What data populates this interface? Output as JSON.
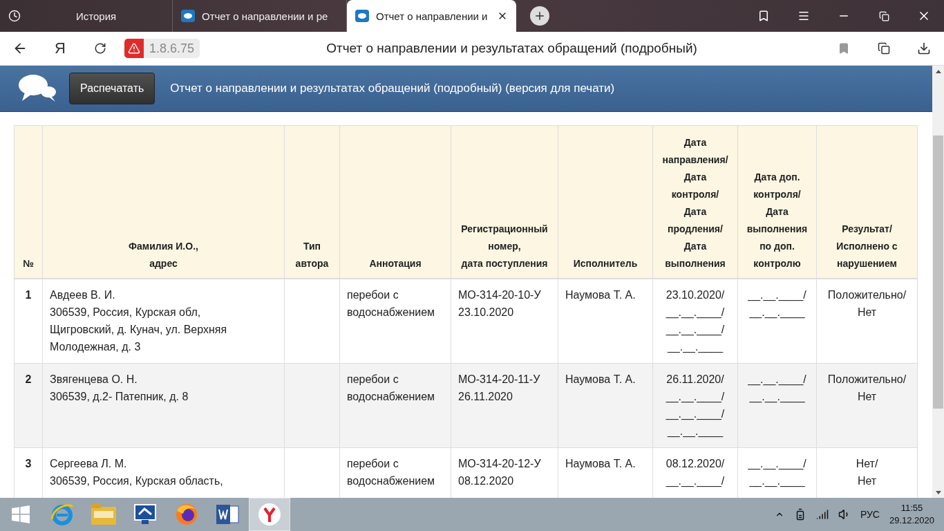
{
  "browser": {
    "tabs": [
      {
        "kind": "history",
        "title": "История",
        "selected": false
      },
      {
        "kind": "page",
        "title": "Отчет о направлении и ре",
        "selected": false
      },
      {
        "kind": "page",
        "title": "Отчет о направлении и",
        "selected": true
      }
    ],
    "logo": "Я",
    "url": "1.8.6.75",
    "page_title": "Отчет о направлении и результатах обращений (подробный)"
  },
  "header": {
    "print_button": "Распечатать",
    "title": "Отчет о направлении и результатах обращений (подробный) (версия для печати)"
  },
  "table": {
    "columns": [
      [
        "№"
      ],
      [
        "Фамилия И.О.,",
        "адрес"
      ],
      [
        "Тип",
        "автора"
      ],
      [
        "Аннотация"
      ],
      [
        "Регистрационный",
        "номер,",
        "дата поступления"
      ],
      [
        "Исполнитель"
      ],
      [
        "Дата",
        "направления/",
        "Дата",
        "контроля/",
        "Дата",
        "продления/",
        "Дата",
        "выполнения"
      ],
      [
        "Дата доп.",
        "контроля/",
        "Дата",
        "выполнения",
        "по доп.",
        "контролю"
      ],
      [
        "Результат/",
        "Исполнено с",
        "нарушением"
      ]
    ],
    "rows": [
      {
        "number": "1",
        "name": "Авдеев В. И.",
        "address": [
          "306539, Россия, Курская обл,",
          "Щигровский, д. Кунач, ул. Верхняя",
          "Молодежная, д. 3"
        ],
        "annotation": [
          "перебои с",
          "водоснабжением"
        ],
        "registration": [
          "МО-314-20-10-У",
          "23.10.2020"
        ],
        "executor": "Наумова Т. А.",
        "dates": [
          "23.10.2020/",
          "__.__.____/",
          "__.__.____/",
          "__.__.____"
        ],
        "extra_dates": [
          "__.__.____/",
          "__.__.____"
        ],
        "result": [
          "Положительно/",
          "Нет"
        ]
      },
      {
        "number": "2",
        "name": "Звягенцева О. Н.",
        "address": [
          "306539, д.2- Патепник, д. 8"
        ],
        "annotation": [
          "перебои с",
          "водоснабжением"
        ],
        "registration": [
          "МО-314-20-11-У",
          "26.11.2020"
        ],
        "executor": "Наумова Т. А.",
        "dates": [
          "26.11.2020/",
          "__.__.____/",
          "__.__.____/",
          "__.__.____"
        ],
        "extra_dates": [
          "__.__.____/",
          "__.__.____"
        ],
        "result": [
          "Положительно/",
          "Нет"
        ]
      },
      {
        "number": "3",
        "name": "Сергеева Л. М.",
        "address": [
          "306539, Россия, Курская область,"
        ],
        "annotation": [
          "перебои с",
          "водоснабжением"
        ],
        "registration": [
          "МО-314-20-12-У",
          "08.12.2020"
        ],
        "executor": "Наумова Т. А.",
        "dates": [
          "08.12.2020/",
          "__.__.____/"
        ],
        "extra_dates": [
          "__.__.____/",
          "__.__.____"
        ],
        "result": [
          "Нет/",
          "Нет"
        ]
      }
    ]
  },
  "taskbar": {
    "language": "РУС",
    "time": "11:55",
    "date": "29.12.2020"
  }
}
